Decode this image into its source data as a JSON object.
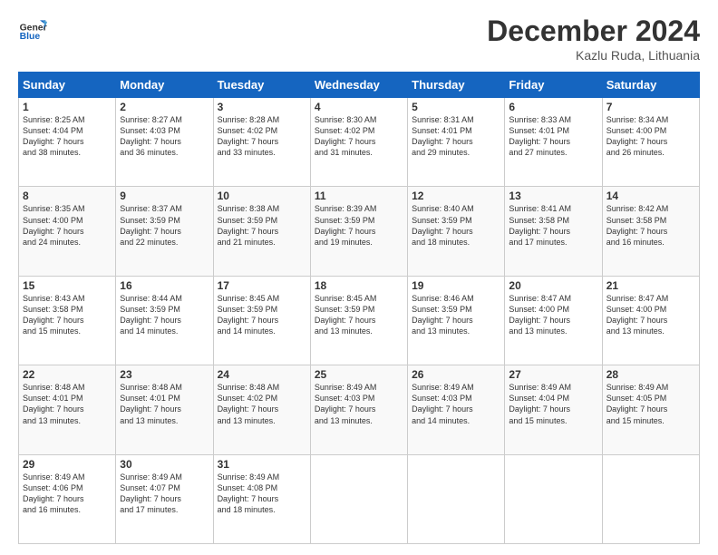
{
  "logo": {
    "general": "General",
    "blue": "Blue"
  },
  "header": {
    "month": "December 2024",
    "location": "Kazlu Ruda, Lithuania"
  },
  "days_of_week": [
    "Sunday",
    "Monday",
    "Tuesday",
    "Wednesday",
    "Thursday",
    "Friday",
    "Saturday"
  ],
  "weeks": [
    [
      {
        "day": "1",
        "info": "Sunrise: 8:25 AM\nSunset: 4:04 PM\nDaylight: 7 hours\nand 38 minutes."
      },
      {
        "day": "2",
        "info": "Sunrise: 8:27 AM\nSunset: 4:03 PM\nDaylight: 7 hours\nand 36 minutes."
      },
      {
        "day": "3",
        "info": "Sunrise: 8:28 AM\nSunset: 4:02 PM\nDaylight: 7 hours\nand 33 minutes."
      },
      {
        "day": "4",
        "info": "Sunrise: 8:30 AM\nSunset: 4:02 PM\nDaylight: 7 hours\nand 31 minutes."
      },
      {
        "day": "5",
        "info": "Sunrise: 8:31 AM\nSunset: 4:01 PM\nDaylight: 7 hours\nand 29 minutes."
      },
      {
        "day": "6",
        "info": "Sunrise: 8:33 AM\nSunset: 4:01 PM\nDaylight: 7 hours\nand 27 minutes."
      },
      {
        "day": "7",
        "info": "Sunrise: 8:34 AM\nSunset: 4:00 PM\nDaylight: 7 hours\nand 26 minutes."
      }
    ],
    [
      {
        "day": "8",
        "info": "Sunrise: 8:35 AM\nSunset: 4:00 PM\nDaylight: 7 hours\nand 24 minutes."
      },
      {
        "day": "9",
        "info": "Sunrise: 8:37 AM\nSunset: 3:59 PM\nDaylight: 7 hours\nand 22 minutes."
      },
      {
        "day": "10",
        "info": "Sunrise: 8:38 AM\nSunset: 3:59 PM\nDaylight: 7 hours\nand 21 minutes."
      },
      {
        "day": "11",
        "info": "Sunrise: 8:39 AM\nSunset: 3:59 PM\nDaylight: 7 hours\nand 19 minutes."
      },
      {
        "day": "12",
        "info": "Sunrise: 8:40 AM\nSunset: 3:59 PM\nDaylight: 7 hours\nand 18 minutes."
      },
      {
        "day": "13",
        "info": "Sunrise: 8:41 AM\nSunset: 3:58 PM\nDaylight: 7 hours\nand 17 minutes."
      },
      {
        "day": "14",
        "info": "Sunrise: 8:42 AM\nSunset: 3:58 PM\nDaylight: 7 hours\nand 16 minutes."
      }
    ],
    [
      {
        "day": "15",
        "info": "Sunrise: 8:43 AM\nSunset: 3:58 PM\nDaylight: 7 hours\nand 15 minutes."
      },
      {
        "day": "16",
        "info": "Sunrise: 8:44 AM\nSunset: 3:59 PM\nDaylight: 7 hours\nand 14 minutes."
      },
      {
        "day": "17",
        "info": "Sunrise: 8:45 AM\nSunset: 3:59 PM\nDaylight: 7 hours\nand 14 minutes."
      },
      {
        "day": "18",
        "info": "Sunrise: 8:45 AM\nSunset: 3:59 PM\nDaylight: 7 hours\nand 13 minutes."
      },
      {
        "day": "19",
        "info": "Sunrise: 8:46 AM\nSunset: 3:59 PM\nDaylight: 7 hours\nand 13 minutes."
      },
      {
        "day": "20",
        "info": "Sunrise: 8:47 AM\nSunset: 4:00 PM\nDaylight: 7 hours\nand 13 minutes."
      },
      {
        "day": "21",
        "info": "Sunrise: 8:47 AM\nSunset: 4:00 PM\nDaylight: 7 hours\nand 13 minutes."
      }
    ],
    [
      {
        "day": "22",
        "info": "Sunrise: 8:48 AM\nSunset: 4:01 PM\nDaylight: 7 hours\nand 13 minutes."
      },
      {
        "day": "23",
        "info": "Sunrise: 8:48 AM\nSunset: 4:01 PM\nDaylight: 7 hours\nand 13 minutes."
      },
      {
        "day": "24",
        "info": "Sunrise: 8:48 AM\nSunset: 4:02 PM\nDaylight: 7 hours\nand 13 minutes."
      },
      {
        "day": "25",
        "info": "Sunrise: 8:49 AM\nSunset: 4:03 PM\nDaylight: 7 hours\nand 13 minutes."
      },
      {
        "day": "26",
        "info": "Sunrise: 8:49 AM\nSunset: 4:03 PM\nDaylight: 7 hours\nand 14 minutes."
      },
      {
        "day": "27",
        "info": "Sunrise: 8:49 AM\nSunset: 4:04 PM\nDaylight: 7 hours\nand 15 minutes."
      },
      {
        "day": "28",
        "info": "Sunrise: 8:49 AM\nSunset: 4:05 PM\nDaylight: 7 hours\nand 15 minutes."
      }
    ],
    [
      {
        "day": "29",
        "info": "Sunrise: 8:49 AM\nSunset: 4:06 PM\nDaylight: 7 hours\nand 16 minutes."
      },
      {
        "day": "30",
        "info": "Sunrise: 8:49 AM\nSunset: 4:07 PM\nDaylight: 7 hours\nand 17 minutes."
      },
      {
        "day": "31",
        "info": "Sunrise: 8:49 AM\nSunset: 4:08 PM\nDaylight: 7 hours\nand 18 minutes."
      },
      null,
      null,
      null,
      null
    ]
  ]
}
